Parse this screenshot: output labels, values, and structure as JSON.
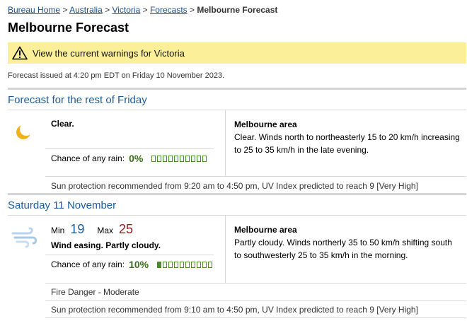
{
  "breadcrumb": {
    "items": [
      "Bureau Home",
      "Australia",
      "Victoria",
      "Forecasts"
    ],
    "separator": ">",
    "current": "Melbourne Forecast"
  },
  "page_title": "Melbourne Forecast",
  "warning": {
    "text": "View the current warnings for Victoria",
    "icon": "warning-triangle-icon"
  },
  "issued": "Forecast issued at 4:20 pm EDT on Friday 10 November 2023.",
  "days": [
    {
      "title": "Forecast for the rest of Friday",
      "icon": "moon-clear-icon",
      "summary": "Clear.",
      "rain_label": "Chance of any rain:",
      "rain_value": "0%",
      "rain_fraction": 0.0,
      "area_title": "Melbourne area",
      "area_text": "Clear. Winds north to northeasterly 15 to 20 km/h increasing to 25 to 35 km/h in the late evening.",
      "sun_protection": "Sun protection recommended from 9:20 am to 4:50 pm, UV Index predicted to reach 9 [Very High]"
    },
    {
      "title": "Saturday 11 November",
      "icon": "wind-icon",
      "min_label": "Min",
      "min_value": "19",
      "max_label": "Max",
      "max_value": "25",
      "summary": "Wind easing. Partly cloudy.",
      "rain_label": "Chance of any rain:",
      "rain_value": "10%",
      "rain_fraction": 0.1,
      "area_title": "Melbourne area",
      "area_text": "Partly cloudy. Winds northerly 35 to 50 km/h shifting south to southwesterly 25 to 35 km/h in the morning.",
      "fire_danger": "Fire Danger - Moderate",
      "sun_protection": "Sun protection recommended from 9:10 am to 4:50 pm, UV Index predicted to reach 9 [Very High]"
    }
  ],
  "colors": {
    "link": "#1a4f8b",
    "day_title": "#1b5b9a",
    "warning_bg": "#fcef9a",
    "rain_green": "#4b8a2c",
    "max_red": "#9c1b1b"
  }
}
